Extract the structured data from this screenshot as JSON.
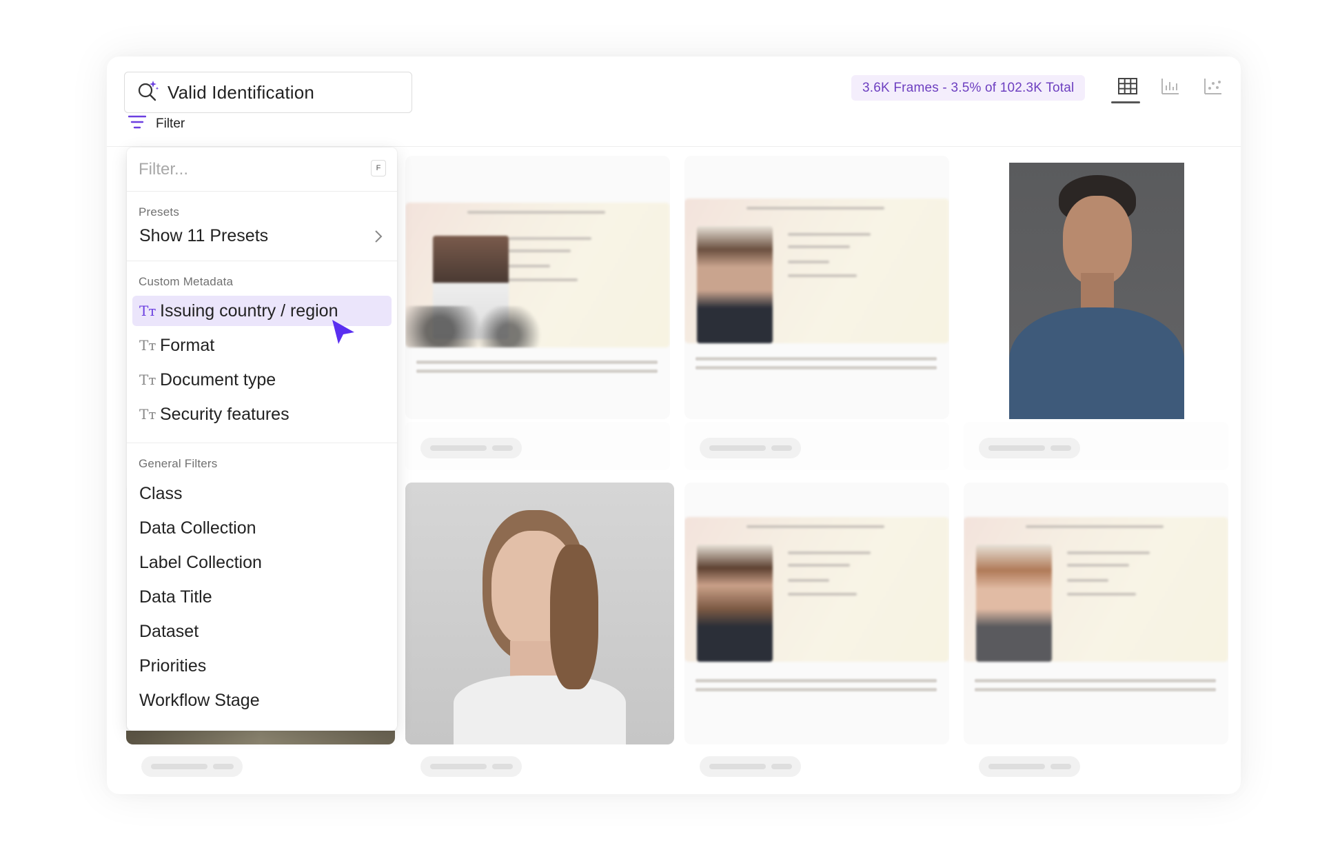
{
  "search": {
    "value": "Valid Identification"
  },
  "filter_toggle": {
    "label": "Filter"
  },
  "frames_badge": "3.6K Frames - 3.5% of 102.3K Total",
  "view_modes": [
    "grid-view-icon",
    "histogram-view-icon",
    "scatter-view-icon"
  ],
  "filter_menu": {
    "input_placeholder": "Filter...",
    "shortcut_key": "F",
    "presets": {
      "label": "Presets",
      "item": "Show 11 Presets"
    },
    "custom_metadata": {
      "label": "Custom Metadata",
      "items": [
        "Issuing country / region",
        "Format",
        "Document type",
        "Security features"
      ],
      "highlighted": "Issuing country / region"
    },
    "general_filters": {
      "label": "General Filters",
      "items": [
        "Class",
        "Data Collection",
        "Label Collection",
        "Data Title",
        "Dataset",
        "Priorities",
        "Workflow Stage"
      ]
    }
  },
  "colors": {
    "accent": "#6b3fe0",
    "badge_bg": "#f4eefc",
    "badge_text": "#6d3fc0",
    "highlight_bg": "#ebe5fb"
  }
}
